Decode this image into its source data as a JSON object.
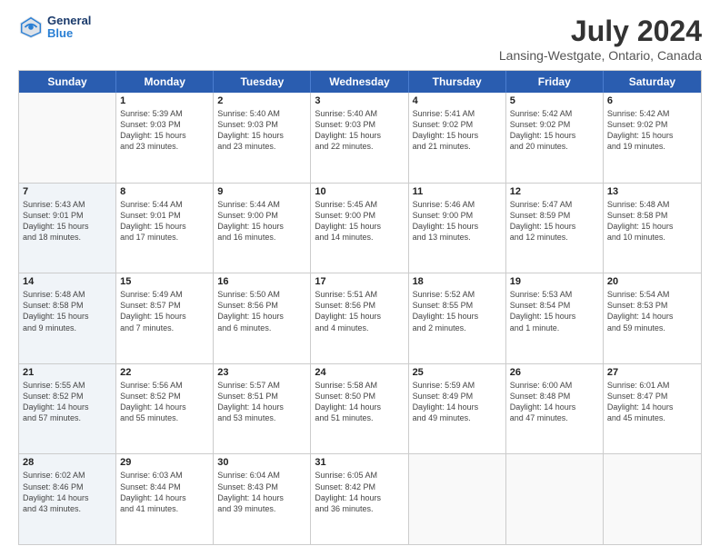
{
  "header": {
    "logo_line1": "General",
    "logo_line2": "Blue",
    "month_year": "July 2024",
    "location": "Lansing-Westgate, Ontario, Canada"
  },
  "days_of_week": [
    "Sunday",
    "Monday",
    "Tuesday",
    "Wednesday",
    "Thursday",
    "Friday",
    "Saturday"
  ],
  "weeks": [
    [
      {
        "num": "",
        "lines": [],
        "empty": true
      },
      {
        "num": "1",
        "lines": [
          "Sunrise: 5:39 AM",
          "Sunset: 9:03 PM",
          "Daylight: 15 hours",
          "and 23 minutes."
        ],
        "empty": false
      },
      {
        "num": "2",
        "lines": [
          "Sunrise: 5:40 AM",
          "Sunset: 9:03 PM",
          "Daylight: 15 hours",
          "and 23 minutes."
        ],
        "empty": false
      },
      {
        "num": "3",
        "lines": [
          "Sunrise: 5:40 AM",
          "Sunset: 9:03 PM",
          "Daylight: 15 hours",
          "and 22 minutes."
        ],
        "empty": false
      },
      {
        "num": "4",
        "lines": [
          "Sunrise: 5:41 AM",
          "Sunset: 9:02 PM",
          "Daylight: 15 hours",
          "and 21 minutes."
        ],
        "empty": false
      },
      {
        "num": "5",
        "lines": [
          "Sunrise: 5:42 AM",
          "Sunset: 9:02 PM",
          "Daylight: 15 hours",
          "and 20 minutes."
        ],
        "empty": false
      },
      {
        "num": "6",
        "lines": [
          "Sunrise: 5:42 AM",
          "Sunset: 9:02 PM",
          "Daylight: 15 hours",
          "and 19 minutes."
        ],
        "empty": false
      }
    ],
    [
      {
        "num": "7",
        "lines": [
          "Sunrise: 5:43 AM",
          "Sunset: 9:01 PM",
          "Daylight: 15 hours",
          "and 18 minutes."
        ],
        "empty": false,
        "shaded": true
      },
      {
        "num": "8",
        "lines": [
          "Sunrise: 5:44 AM",
          "Sunset: 9:01 PM",
          "Daylight: 15 hours",
          "and 17 minutes."
        ],
        "empty": false
      },
      {
        "num": "9",
        "lines": [
          "Sunrise: 5:44 AM",
          "Sunset: 9:00 PM",
          "Daylight: 15 hours",
          "and 16 minutes."
        ],
        "empty": false
      },
      {
        "num": "10",
        "lines": [
          "Sunrise: 5:45 AM",
          "Sunset: 9:00 PM",
          "Daylight: 15 hours",
          "and 14 minutes."
        ],
        "empty": false
      },
      {
        "num": "11",
        "lines": [
          "Sunrise: 5:46 AM",
          "Sunset: 9:00 PM",
          "Daylight: 15 hours",
          "and 13 minutes."
        ],
        "empty": false
      },
      {
        "num": "12",
        "lines": [
          "Sunrise: 5:47 AM",
          "Sunset: 8:59 PM",
          "Daylight: 15 hours",
          "and 12 minutes."
        ],
        "empty": false
      },
      {
        "num": "13",
        "lines": [
          "Sunrise: 5:48 AM",
          "Sunset: 8:58 PM",
          "Daylight: 15 hours",
          "and 10 minutes."
        ],
        "empty": false
      }
    ],
    [
      {
        "num": "14",
        "lines": [
          "Sunrise: 5:48 AM",
          "Sunset: 8:58 PM",
          "Daylight: 15 hours",
          "and 9 minutes."
        ],
        "empty": false,
        "shaded": true
      },
      {
        "num": "15",
        "lines": [
          "Sunrise: 5:49 AM",
          "Sunset: 8:57 PM",
          "Daylight: 15 hours",
          "and 7 minutes."
        ],
        "empty": false
      },
      {
        "num": "16",
        "lines": [
          "Sunrise: 5:50 AM",
          "Sunset: 8:56 PM",
          "Daylight: 15 hours",
          "and 6 minutes."
        ],
        "empty": false
      },
      {
        "num": "17",
        "lines": [
          "Sunrise: 5:51 AM",
          "Sunset: 8:56 PM",
          "Daylight: 15 hours",
          "and 4 minutes."
        ],
        "empty": false
      },
      {
        "num": "18",
        "lines": [
          "Sunrise: 5:52 AM",
          "Sunset: 8:55 PM",
          "Daylight: 15 hours",
          "and 2 minutes."
        ],
        "empty": false
      },
      {
        "num": "19",
        "lines": [
          "Sunrise: 5:53 AM",
          "Sunset: 8:54 PM",
          "Daylight: 15 hours",
          "and 1 minute."
        ],
        "empty": false
      },
      {
        "num": "20",
        "lines": [
          "Sunrise: 5:54 AM",
          "Sunset: 8:53 PM",
          "Daylight: 14 hours",
          "and 59 minutes."
        ],
        "empty": false
      }
    ],
    [
      {
        "num": "21",
        "lines": [
          "Sunrise: 5:55 AM",
          "Sunset: 8:52 PM",
          "Daylight: 14 hours",
          "and 57 minutes."
        ],
        "empty": false,
        "shaded": true
      },
      {
        "num": "22",
        "lines": [
          "Sunrise: 5:56 AM",
          "Sunset: 8:52 PM",
          "Daylight: 14 hours",
          "and 55 minutes."
        ],
        "empty": false
      },
      {
        "num": "23",
        "lines": [
          "Sunrise: 5:57 AM",
          "Sunset: 8:51 PM",
          "Daylight: 14 hours",
          "and 53 minutes."
        ],
        "empty": false
      },
      {
        "num": "24",
        "lines": [
          "Sunrise: 5:58 AM",
          "Sunset: 8:50 PM",
          "Daylight: 14 hours",
          "and 51 minutes."
        ],
        "empty": false
      },
      {
        "num": "25",
        "lines": [
          "Sunrise: 5:59 AM",
          "Sunset: 8:49 PM",
          "Daylight: 14 hours",
          "and 49 minutes."
        ],
        "empty": false
      },
      {
        "num": "26",
        "lines": [
          "Sunrise: 6:00 AM",
          "Sunset: 8:48 PM",
          "Daylight: 14 hours",
          "and 47 minutes."
        ],
        "empty": false
      },
      {
        "num": "27",
        "lines": [
          "Sunrise: 6:01 AM",
          "Sunset: 8:47 PM",
          "Daylight: 14 hours",
          "and 45 minutes."
        ],
        "empty": false
      }
    ],
    [
      {
        "num": "28",
        "lines": [
          "Sunrise: 6:02 AM",
          "Sunset: 8:46 PM",
          "Daylight: 14 hours",
          "and 43 minutes."
        ],
        "empty": false,
        "shaded": true
      },
      {
        "num": "29",
        "lines": [
          "Sunrise: 6:03 AM",
          "Sunset: 8:44 PM",
          "Daylight: 14 hours",
          "and 41 minutes."
        ],
        "empty": false
      },
      {
        "num": "30",
        "lines": [
          "Sunrise: 6:04 AM",
          "Sunset: 8:43 PM",
          "Daylight: 14 hours",
          "and 39 minutes."
        ],
        "empty": false
      },
      {
        "num": "31",
        "lines": [
          "Sunrise: 6:05 AM",
          "Sunset: 8:42 PM",
          "Daylight: 14 hours",
          "and 36 minutes."
        ],
        "empty": false
      },
      {
        "num": "",
        "lines": [],
        "empty": true
      },
      {
        "num": "",
        "lines": [],
        "empty": true
      },
      {
        "num": "",
        "lines": [],
        "empty": true
      }
    ]
  ]
}
